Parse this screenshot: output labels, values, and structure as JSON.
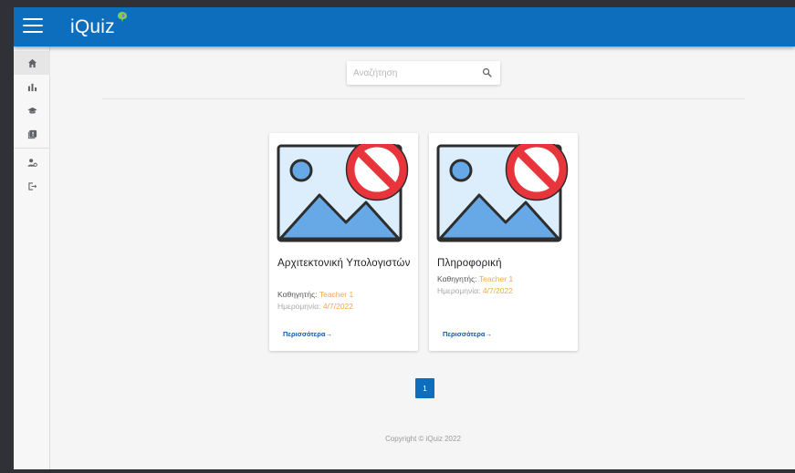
{
  "app": {
    "brand": "iQuiz"
  },
  "sidebar": {
    "items": [
      {
        "icon": "home-icon"
      },
      {
        "icon": "bar-chart-icon"
      },
      {
        "icon": "graduation-cap-icon"
      },
      {
        "icon": "quiz-book-icon"
      },
      {
        "icon": "user-settings-icon"
      },
      {
        "icon": "logout-icon"
      }
    ]
  },
  "search": {
    "placeholder": "Αναζήτηση",
    "value": ""
  },
  "courses": [
    {
      "title": "Αρχιτεκτονική Υπολογιστών",
      "teacher_label": "Καθηγητής:",
      "teacher": "Teacher 1",
      "date_label": "Ημερομηνία:",
      "date": "4/7/2022",
      "more": "Περισσότερα→"
    },
    {
      "title": "Πληροφορική",
      "teacher_label": "Καθηγητής:",
      "teacher": "Teacher 1",
      "date_label": "Ημερομηνία:",
      "date": "4/7/2022",
      "more": "Περισσότερα→"
    }
  ],
  "pagination": {
    "current": "1"
  },
  "footer": {
    "copyright": "Copyright © iQuiz 2022"
  },
  "colors": {
    "appbar": "#0d6ebd",
    "accent_value": "#f2a94a",
    "link": "#0d5aa7",
    "no_sign": "#e8353b"
  }
}
